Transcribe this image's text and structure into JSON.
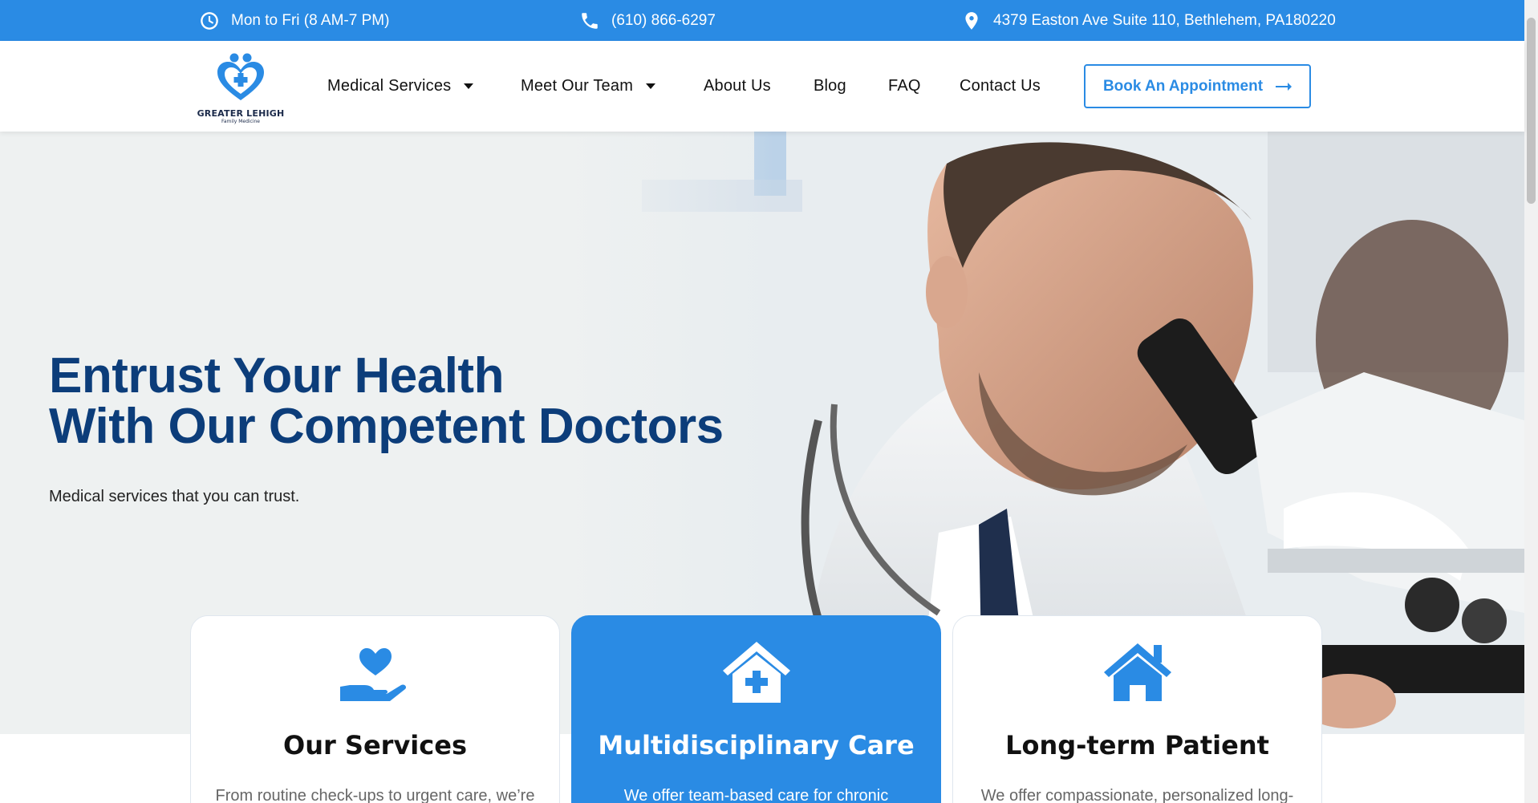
{
  "topbar": {
    "hours": "Mon to Fri (8 AM-7 PM)",
    "phone": "(610) 866-6297",
    "address": "4379 Easton Ave Suite 110, Bethlehem, PA180220"
  },
  "logo": {
    "name": "GREATER LEHIGH",
    "sub": "Family Medicine"
  },
  "nav": {
    "medical_services": "Medical Services",
    "meet_team": "Meet Our Team",
    "about": "About Us",
    "blog": "Blog",
    "faq": "FAQ",
    "contact": "Contact Us",
    "book": "Book An Appointment"
  },
  "hero": {
    "title_line1": "Entrust Your Health",
    "title_line2": "With Our Competent Doctors",
    "subtitle": "Medical services that you can trust."
  },
  "cards": [
    {
      "title": "Our Services",
      "desc": "From routine check-ups to urgent care, we’re",
      "icon": "heart-hand-icon"
    },
    {
      "title": "Multidisciplinary Care",
      "desc": "We offer team-based care for chronic",
      "icon": "medical-house-icon"
    },
    {
      "title": "Long-term Patient",
      "desc": "We offer compassionate, personalized long-",
      "icon": "home-icon"
    }
  ],
  "colors": {
    "accent": "#2a8be4",
    "hero_title": "#0c3d7a"
  }
}
